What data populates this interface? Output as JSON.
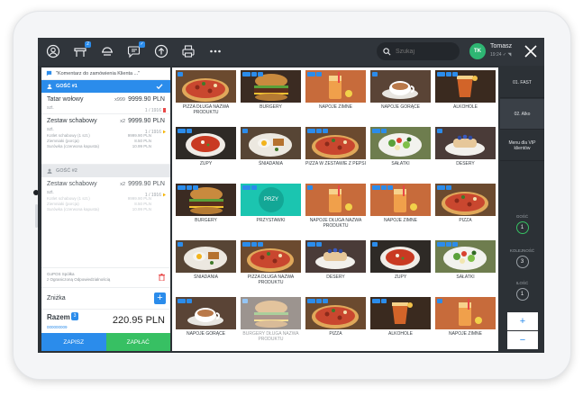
{
  "topbar": {
    "icons": [
      "user-icon",
      "table-icon",
      "takeaway-icon",
      "chat-icon",
      "upload-icon",
      "printer-icon",
      "more-icon"
    ],
    "search_placeholder": "Szukaj",
    "user": {
      "initials": "TK",
      "name": "Tomasz",
      "sub": "19:24 ✓ ◥"
    }
  },
  "order": {
    "comment": "\"Komentarz do zamówienia Klienta ...\"",
    "guest1": "GOŚĆ #1",
    "guest2": "GOŚĆ #2",
    "items": [
      {
        "name": "Tatar wołowy",
        "qty": "x999",
        "price": "9999.90 PLN",
        "unit": "szt.",
        "course": "1 / 1916"
      },
      {
        "name": "Zestaw schabowy",
        "qty": "x2",
        "price": "9999.90 PLN",
        "unit": "szt.",
        "course": "1 / 1916",
        "mods": [
          {
            "name": "Kotlet schabowy (1 szt.)",
            "price": "9999.90 PLN"
          },
          {
            "name": "Ziemniaki (porcja)",
            "price": "8.50 PLN"
          },
          {
            "name": "Surówka (czerwona kapusta)",
            "price": "10.99 PLN"
          }
        ]
      },
      {
        "name": "Zestaw schabowy",
        "qty": "x2",
        "price": "9999.90 PLN",
        "unit": "szt.",
        "course": "1 / 1916",
        "mods": [
          {
            "name": "Kotlet schabowy (1 szt.)",
            "price": "9999.90 PLN"
          },
          {
            "name": "Ziemniaki (porcja)",
            "price": "8.50 PLN"
          },
          {
            "name": "Surówka (czerwona kapusta)",
            "price": "10.99 PLN"
          }
        ]
      }
    ],
    "legal": [
      "GoPOS Spółka",
      "z Ograniczoną Odpowiedzialnością"
    ],
    "discount_label": "Zniżka",
    "total_label": "Razem",
    "total_tag": "3",
    "total_sub": "000000009",
    "total_amount": "220.95 PLN",
    "save_label": "ZAPISZ",
    "pay_label": "ZAPŁAĆ"
  },
  "tiles": [
    {
      "label": "PIZZA DŁUGA NAZWA PRODUKTU",
      "kind": "pizza"
    },
    {
      "label": "BURGERY",
      "kind": "burger"
    },
    {
      "label": "NAPOJE ZIMNE",
      "kind": "cold"
    },
    {
      "label": "NAPOJE GORĄCE",
      "kind": "hot"
    },
    {
      "label": "ALKOHOLE",
      "kind": "alco"
    },
    {
      "label": "ZUPY",
      "kind": "soup"
    },
    {
      "label": "ŚNIADANIA",
      "kind": "breakfast"
    },
    {
      "label": "PIZZA W ZESTAWIE Z PEPSI",
      "kind": "pizza"
    },
    {
      "label": "SAŁATKI",
      "kind": "salad"
    },
    {
      "label": "DESERY",
      "kind": "dessert"
    },
    {
      "label": "BURGERY",
      "kind": "burger"
    },
    {
      "label": "PRZYSTAWKI",
      "kind": "teal",
      "circle": "PRZY"
    },
    {
      "label": "NAPOJE DŁUGA NAZWA PRODUKTU",
      "kind": "cold"
    },
    {
      "label": "NAPOJE ZIMNE",
      "kind": "cold"
    },
    {
      "label": "PIZZA",
      "kind": "pizza"
    },
    {
      "label": "ŚNIADANIA",
      "kind": "breakfast"
    },
    {
      "label": "PIZZA DŁUGA NAZWA PRODUKTU",
      "kind": "pizza"
    },
    {
      "label": "DESERY",
      "kind": "dessert"
    },
    {
      "label": "ZUPY",
      "kind": "soup"
    },
    {
      "label": "SAŁATKI",
      "kind": "salad"
    },
    {
      "label": "NAPOJE GORĄCE",
      "kind": "hot"
    },
    {
      "label": "BURGERY DŁUGA NAZWA PRODUKTU",
      "kind": "burger",
      "faded": true
    },
    {
      "label": "PIZZA",
      "kind": "pizza"
    },
    {
      "label": "ALKOHOLE",
      "kind": "alco"
    },
    {
      "label": "NAPOJE ZIMNE",
      "kind": "cold"
    }
  ],
  "side": {
    "menus": [
      "01. FAST",
      "02. Alko",
      "Menu dla VIP klientów"
    ],
    "guest_label": "GOŚĆ",
    "guest_value": "1",
    "course_label": "KOLEJNOŚĆ",
    "course_value": "3",
    "qty_label": "ILOŚĆ",
    "qty_value": "1",
    "plus": "+",
    "minus": "−"
  },
  "colors": {
    "accent": "#2b8ceb",
    "pay": "#37c063",
    "topbar": "#30353b",
    "teal": "#1bc5b0"
  }
}
